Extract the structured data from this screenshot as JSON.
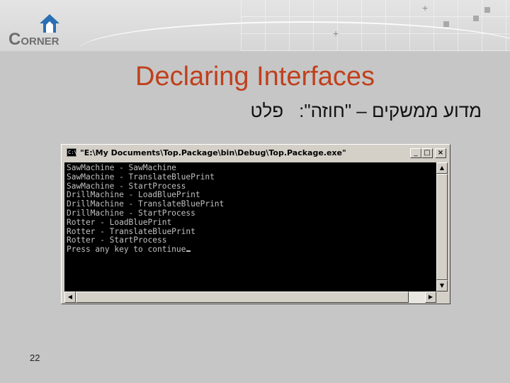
{
  "slide": {
    "logo_text_big": "C",
    "logo_text_rest": "ORNER",
    "title": "Declaring Interfaces",
    "subtitle_main": "מדוע ממשקים – \"חוזה\":",
    "subtitle_tail": "פלט",
    "page_number": "22",
    "colors": {
      "title": "#c0401c",
      "background": "#c6c6c6",
      "console_bg": "#000000",
      "console_text": "#c0c0c0"
    }
  },
  "console_window": {
    "icon_label": "C:\\",
    "title": "\"E:\\My Documents\\Top.Package\\bin\\Debug\\Top.Package.exe\"",
    "buttons": {
      "minimize": "_",
      "maximize": "□",
      "close": "×"
    },
    "lines": [
      "SawMachine - SawMachine",
      "SawMachine - TranslateBluePrint",
      "SawMachine - StartProcess",
      "DrillMachine - LoadBluePrint",
      "DrillMachine - TranslateBluePrint",
      "DrillMachine - StartProcess",
      "Rotter - LoadBluePrint",
      "Rotter - TranslateBluePrint",
      "Rotter - StartProcess",
      "Press any key to continue"
    ],
    "scroll_arrows": {
      "up": "▲",
      "down": "▼",
      "left": "◀",
      "right": "▶"
    }
  }
}
